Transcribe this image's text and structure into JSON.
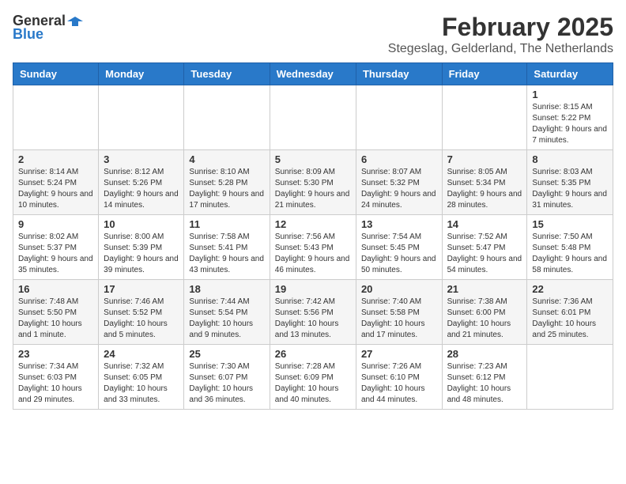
{
  "logo": {
    "general": "General",
    "blue": "Blue"
  },
  "title": "February 2025",
  "location": "Stegeslag, Gelderland, The Netherlands",
  "days_of_week": [
    "Sunday",
    "Monday",
    "Tuesday",
    "Wednesday",
    "Thursday",
    "Friday",
    "Saturday"
  ],
  "weeks": [
    [
      {
        "day": "",
        "info": ""
      },
      {
        "day": "",
        "info": ""
      },
      {
        "day": "",
        "info": ""
      },
      {
        "day": "",
        "info": ""
      },
      {
        "day": "",
        "info": ""
      },
      {
        "day": "",
        "info": ""
      },
      {
        "day": "1",
        "info": "Sunrise: 8:15 AM\nSunset: 5:22 PM\nDaylight: 9 hours and 7 minutes."
      }
    ],
    [
      {
        "day": "2",
        "info": "Sunrise: 8:14 AM\nSunset: 5:24 PM\nDaylight: 9 hours and 10 minutes."
      },
      {
        "day": "3",
        "info": "Sunrise: 8:12 AM\nSunset: 5:26 PM\nDaylight: 9 hours and 14 minutes."
      },
      {
        "day": "4",
        "info": "Sunrise: 8:10 AM\nSunset: 5:28 PM\nDaylight: 9 hours and 17 minutes."
      },
      {
        "day": "5",
        "info": "Sunrise: 8:09 AM\nSunset: 5:30 PM\nDaylight: 9 hours and 21 minutes."
      },
      {
        "day": "6",
        "info": "Sunrise: 8:07 AM\nSunset: 5:32 PM\nDaylight: 9 hours and 24 minutes."
      },
      {
        "day": "7",
        "info": "Sunrise: 8:05 AM\nSunset: 5:34 PM\nDaylight: 9 hours and 28 minutes."
      },
      {
        "day": "8",
        "info": "Sunrise: 8:03 AM\nSunset: 5:35 PM\nDaylight: 9 hours and 31 minutes."
      }
    ],
    [
      {
        "day": "9",
        "info": "Sunrise: 8:02 AM\nSunset: 5:37 PM\nDaylight: 9 hours and 35 minutes."
      },
      {
        "day": "10",
        "info": "Sunrise: 8:00 AM\nSunset: 5:39 PM\nDaylight: 9 hours and 39 minutes."
      },
      {
        "day": "11",
        "info": "Sunrise: 7:58 AM\nSunset: 5:41 PM\nDaylight: 9 hours and 43 minutes."
      },
      {
        "day": "12",
        "info": "Sunrise: 7:56 AM\nSunset: 5:43 PM\nDaylight: 9 hours and 46 minutes."
      },
      {
        "day": "13",
        "info": "Sunrise: 7:54 AM\nSunset: 5:45 PM\nDaylight: 9 hours and 50 minutes."
      },
      {
        "day": "14",
        "info": "Sunrise: 7:52 AM\nSunset: 5:47 PM\nDaylight: 9 hours and 54 minutes."
      },
      {
        "day": "15",
        "info": "Sunrise: 7:50 AM\nSunset: 5:48 PM\nDaylight: 9 hours and 58 minutes."
      }
    ],
    [
      {
        "day": "16",
        "info": "Sunrise: 7:48 AM\nSunset: 5:50 PM\nDaylight: 10 hours and 1 minute."
      },
      {
        "day": "17",
        "info": "Sunrise: 7:46 AM\nSunset: 5:52 PM\nDaylight: 10 hours and 5 minutes."
      },
      {
        "day": "18",
        "info": "Sunrise: 7:44 AM\nSunset: 5:54 PM\nDaylight: 10 hours and 9 minutes."
      },
      {
        "day": "19",
        "info": "Sunrise: 7:42 AM\nSunset: 5:56 PM\nDaylight: 10 hours and 13 minutes."
      },
      {
        "day": "20",
        "info": "Sunrise: 7:40 AM\nSunset: 5:58 PM\nDaylight: 10 hours and 17 minutes."
      },
      {
        "day": "21",
        "info": "Sunrise: 7:38 AM\nSunset: 6:00 PM\nDaylight: 10 hours and 21 minutes."
      },
      {
        "day": "22",
        "info": "Sunrise: 7:36 AM\nSunset: 6:01 PM\nDaylight: 10 hours and 25 minutes."
      }
    ],
    [
      {
        "day": "23",
        "info": "Sunrise: 7:34 AM\nSunset: 6:03 PM\nDaylight: 10 hours and 29 minutes."
      },
      {
        "day": "24",
        "info": "Sunrise: 7:32 AM\nSunset: 6:05 PM\nDaylight: 10 hours and 33 minutes."
      },
      {
        "day": "25",
        "info": "Sunrise: 7:30 AM\nSunset: 6:07 PM\nDaylight: 10 hours and 36 minutes."
      },
      {
        "day": "26",
        "info": "Sunrise: 7:28 AM\nSunset: 6:09 PM\nDaylight: 10 hours and 40 minutes."
      },
      {
        "day": "27",
        "info": "Sunrise: 7:26 AM\nSunset: 6:10 PM\nDaylight: 10 hours and 44 minutes."
      },
      {
        "day": "28",
        "info": "Sunrise: 7:23 AM\nSunset: 6:12 PM\nDaylight: 10 hours and 48 minutes."
      },
      {
        "day": "",
        "info": ""
      }
    ]
  ]
}
